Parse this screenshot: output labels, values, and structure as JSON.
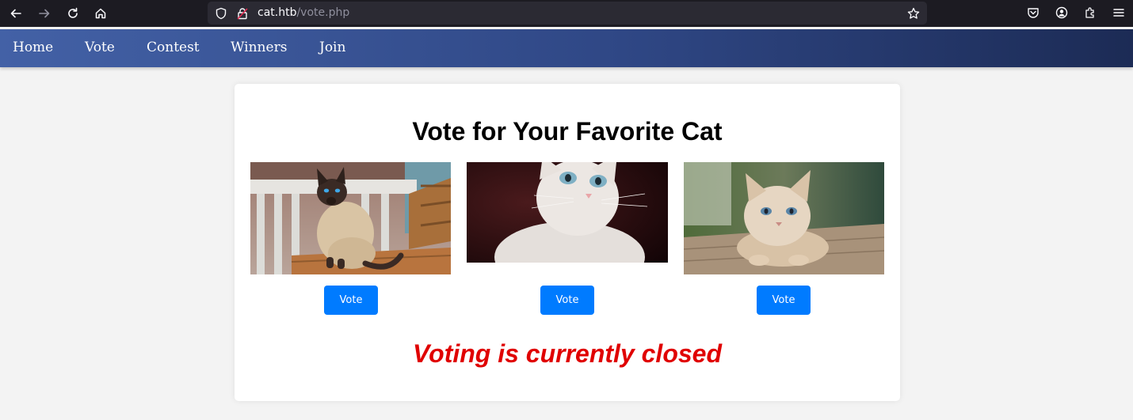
{
  "browser": {
    "url_host": "cat.htb",
    "url_path": "/vote.php"
  },
  "nav": {
    "items": [
      {
        "label": "Home"
      },
      {
        "label": "Vote"
      },
      {
        "label": "Contest"
      },
      {
        "label": "Winners"
      },
      {
        "label": "Join"
      }
    ]
  },
  "main": {
    "title": "Vote for Your Favorite Cat",
    "cats": [
      {
        "image": "siamese-cat-photo",
        "vote_label": "Vote"
      },
      {
        "image": "white-kitten-photo",
        "vote_label": "Vote"
      },
      {
        "image": "fluffy-kitten-photo",
        "vote_label": "Vote"
      }
    ],
    "status_message": "Voting is currently closed"
  },
  "colors": {
    "accent": "#007bff",
    "status": "#e00000",
    "nav_start": "#4361a6",
    "nav_end": "#1c2b55"
  }
}
